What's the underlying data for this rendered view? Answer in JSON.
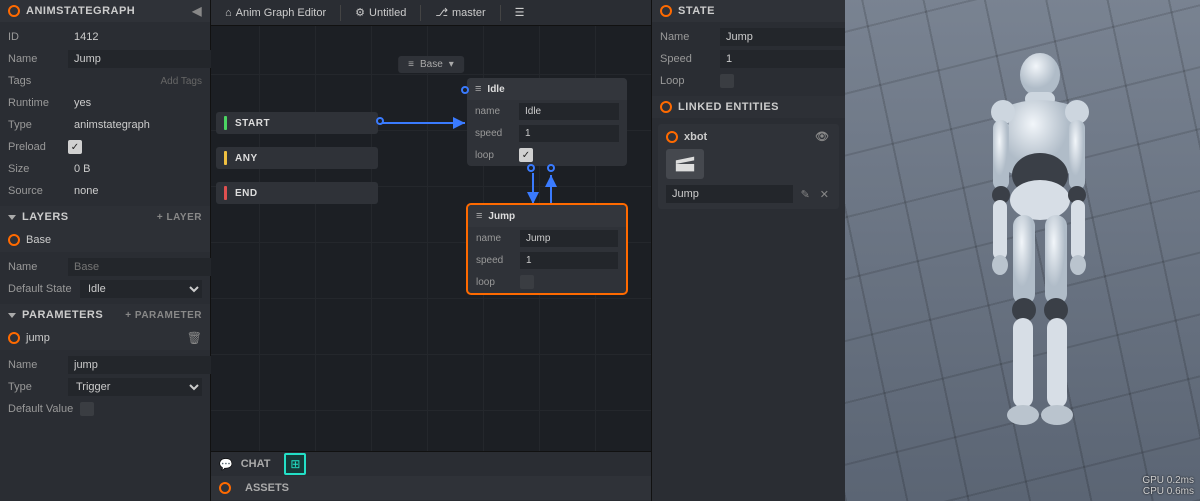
{
  "inspector": {
    "title": "ANIMSTATEGRAPH",
    "rows": {
      "id_label": "ID",
      "id_value": "1412",
      "name_label": "Name",
      "name_value": "Jump",
      "tags_label": "Tags",
      "tags_placeholder": "Add Tags",
      "runtime_label": "Runtime",
      "runtime_value": "yes",
      "type_label": "Type",
      "type_value": "animstategraph",
      "preload_label": "Preload",
      "size_label": "Size",
      "size_value": "0 B",
      "source_label": "Source",
      "source_value": "none"
    },
    "layers": {
      "title": "LAYERS",
      "add": "+ LAYER",
      "base_title": "Base",
      "name_label": "Name",
      "name_placeholder": "Base",
      "default_state_label": "Default State",
      "default_state_value": "Idle"
    },
    "parameters": {
      "title": "PARAMETERS",
      "add": "+ PARAMETER",
      "param_title": "jump",
      "name_label": "Name",
      "name_value": "jump",
      "type_label": "Type",
      "type_value": "Trigger",
      "default_value_label": "Default Value"
    }
  },
  "editor": {
    "tb_home": "Anim Graph Editor",
    "tb_untitled": "Untitled",
    "tb_master": "master",
    "layer_dropdown": "Base",
    "nodes": {
      "start": "START",
      "any": "ANY",
      "end": "END"
    },
    "idle_card": {
      "title": "Idle",
      "name_label": "name",
      "name_value": "Idle",
      "speed_label": "speed",
      "speed_value": "1",
      "loop_label": "loop"
    },
    "jump_card": {
      "title": "Jump",
      "name_label": "name",
      "name_value": "Jump",
      "speed_label": "speed",
      "speed_value": "1",
      "loop_label": "loop"
    },
    "chat_label": "CHAT",
    "assets_label": "ASSETS"
  },
  "state_panel": {
    "title": "STATE",
    "name_label": "Name",
    "name_value": "Jump",
    "speed_label": "Speed",
    "speed_value": "1",
    "loop_label": "Loop",
    "linked_title": "LINKED ENTITIES",
    "entity_name": "xbot",
    "asset_name": "Jump"
  },
  "viewport": {
    "gpu": "GPU  0.2ms",
    "cpu": "CPU  0.6ms"
  }
}
